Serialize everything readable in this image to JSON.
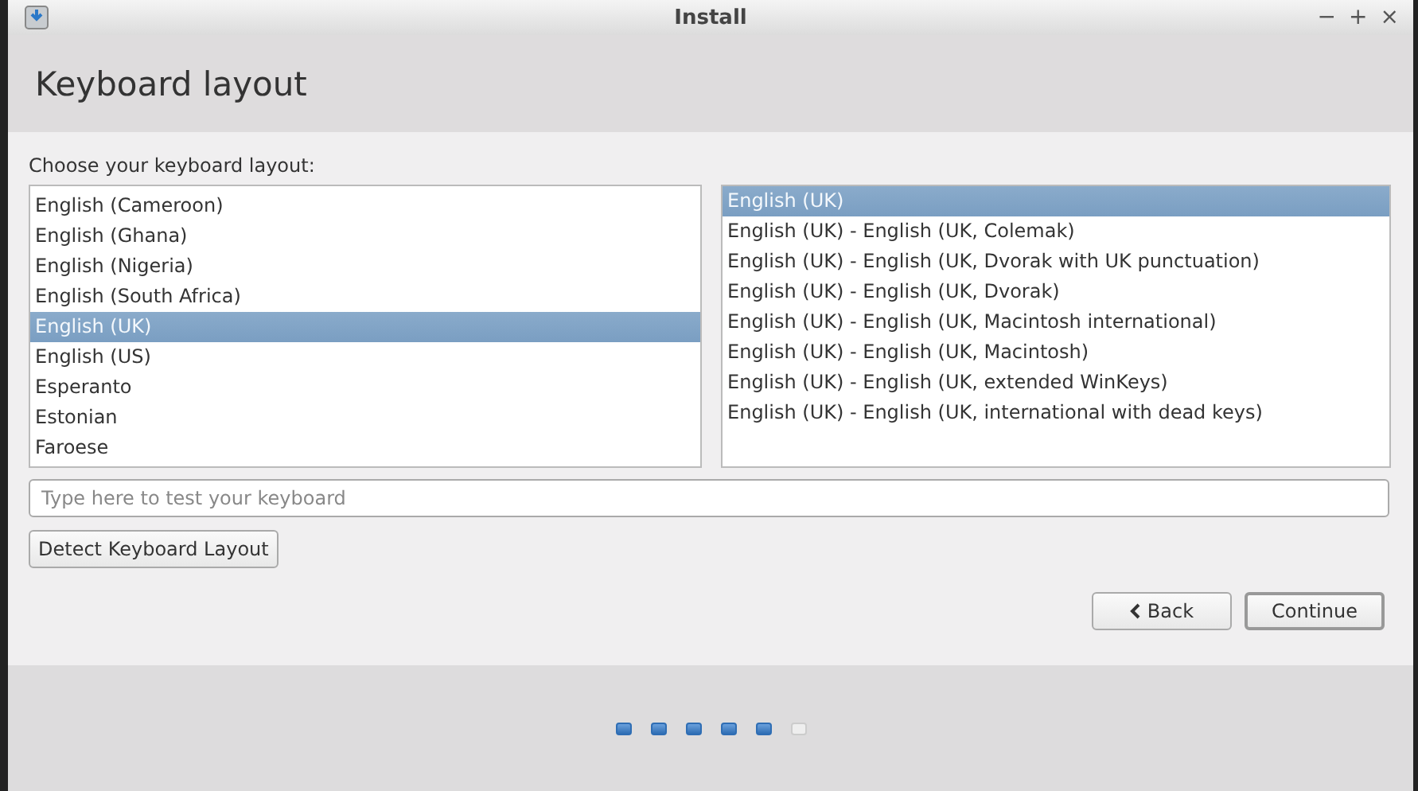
{
  "window": {
    "title": "Install",
    "controls": [
      "−",
      "+",
      "×"
    ]
  },
  "header": {
    "title": "Keyboard layout"
  },
  "prompt": "Choose your keyboard layout:",
  "layouts": [
    {
      "label": "English (Cameroon)",
      "selected": false
    },
    {
      "label": "English (Ghana)",
      "selected": false
    },
    {
      "label": "English (Nigeria)",
      "selected": false
    },
    {
      "label": "English (South Africa)",
      "selected": false
    },
    {
      "label": "English (UK)",
      "selected": true
    },
    {
      "label": "English (US)",
      "selected": false
    },
    {
      "label": "Esperanto",
      "selected": false
    },
    {
      "label": "Estonian",
      "selected": false
    },
    {
      "label": "Faroese",
      "selected": false
    }
  ],
  "variants": [
    {
      "label": "English (UK)",
      "selected": true
    },
    {
      "label": "English (UK) - English (UK, Colemak)",
      "selected": false
    },
    {
      "label": "English (UK) - English (UK, Dvorak with UK punctuation)",
      "selected": false
    },
    {
      "label": "English (UK) - English (UK, Dvorak)",
      "selected": false
    },
    {
      "label": "English (UK) - English (UK, Macintosh international)",
      "selected": false
    },
    {
      "label": "English (UK) - English (UK, Macintosh)",
      "selected": false
    },
    {
      "label": "English (UK) - English (UK, extended WinKeys)",
      "selected": false
    },
    {
      "label": "English (UK) - English (UK, international with dead keys)",
      "selected": false
    }
  ],
  "test_field": {
    "placeholder": "Type here to test your keyboard"
  },
  "detect_button": "Detect Keyboard Layout",
  "buttons": [
    {
      "label": "Back",
      "kind": "back"
    },
    {
      "label": "Continue",
      "kind": "default"
    }
  ],
  "steps": [
    {
      "done": true
    },
    {
      "done": true
    },
    {
      "done": true
    },
    {
      "done": true
    },
    {
      "done": true
    },
    {
      "done": false
    }
  ]
}
